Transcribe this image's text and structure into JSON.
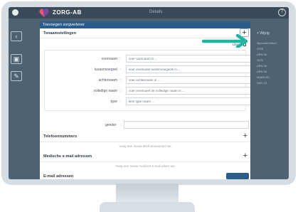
{
  "app": {
    "brand": "ZORG-AB",
    "top_link": "Details",
    "help_icon": "question-icon"
  },
  "rail": {
    "back_icon": "chevron-left-icon",
    "label": "Wijzig",
    "edit_icon": "pencil-icon"
  },
  "background_panel": {
    "add_label": "Wijzig",
    "rows": [
      "Bijzonderheden",
      "2378",
      "ARN-45",
      "2879",
      "ARN-49",
      "ARN-26",
      "MARN-99",
      "SAR-23"
    ]
  },
  "modal": {
    "title": "Toevoegen zorgverlener",
    "name_section": {
      "title": "Tenaamstellingen",
      "add_icon": "plus-icon",
      "language": "USA",
      "fields": [
        {
          "label": "voornaam",
          "placeholder": "voer voornaam in ..."
        },
        {
          "label": "tussenvoegsel",
          "placeholder": "voer eventuele tussenvoegsels in ..."
        },
        {
          "label": "achternaam",
          "placeholder": "voer achternaam in ..."
        },
        {
          "label": "volledige naam",
          "placeholder": "voer eventueel de volledige naam in ..."
        },
        {
          "label": "type",
          "placeholder": "kies type naam ..."
        }
      ]
    },
    "gender_label": "gender",
    "phone": {
      "title": "Telefoonnummers",
      "empty": "Voeg een nieuw telefoonnummer toe"
    },
    "medical_email": {
      "title": "Medische e-mail adressen",
      "empty": "Voeg een nieuw medisch e-mail adres toe"
    },
    "email": {
      "title": "E-mail adressen"
    }
  },
  "colors": {
    "header_blue": "#2b5c8a",
    "arrow_teal": "#1fb5a3",
    "screen_bg": "#4f6272"
  }
}
